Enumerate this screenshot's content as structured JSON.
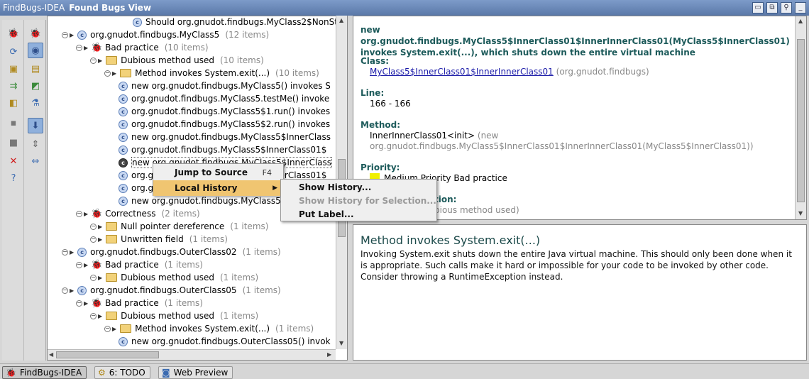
{
  "titlebar": {
    "app_name": "FindBugs-IDEA",
    "view_name": "Found Bugs View",
    "buttons": [
      "restore-icon",
      "float-icon",
      "pin-icon",
      "minimize-icon"
    ]
  },
  "toolbar1": {
    "tools": [
      {
        "name": "analyze-bug-icon",
        "glyph": "🐞"
      },
      {
        "name": "analyze-module-icon",
        "glyph": "⟳"
      },
      {
        "name": "analyze-project-icon",
        "glyph": "▣"
      },
      {
        "name": "analyze-changelist-icon",
        "glyph": "⇉"
      },
      {
        "name": "analyze-scope-icon",
        "glyph": "◧"
      },
      {
        "name": "stop-icon",
        "glyph": "■"
      },
      {
        "name": "close-icon",
        "glyph": "✕"
      },
      {
        "name": "help-icon",
        "glyph": "?"
      }
    ]
  },
  "toolbar2": {
    "tools": [
      {
        "name": "group-by-bug-icon",
        "glyph": "🐞"
      },
      {
        "name": "group-by-class-icon",
        "glyph": "◉"
      },
      {
        "name": "group-by-package-icon",
        "glyph": "▤"
      },
      {
        "name": "group-by-category-icon",
        "glyph": "◩"
      },
      {
        "name": "filter-icon",
        "glyph": "⚗"
      },
      {
        "name": "autoscroll-icon",
        "glyph": "⬇"
      },
      {
        "name": "expand-all-icon",
        "glyph": "⇕"
      },
      {
        "name": "collapse-all-icon",
        "glyph": "⇔"
      }
    ]
  },
  "tree": {
    "rows": [
      {
        "type": "cls",
        "label": "Should org.gnudot.findbugs.MyClass2$NonStat",
        "count": ""
      },
      {
        "type": "cls",
        "label": "org.gnudot.findbugs.MyClass5",
        "count": "(12 items)"
      },
      {
        "type": "bug",
        "label": "Bad practice",
        "count": "(10 items)"
      },
      {
        "type": "folder",
        "label": "Dubious method used",
        "count": "(10 items)"
      },
      {
        "type": "folder",
        "label": "Method invokes System.exit(...)",
        "count": "(10 items)"
      },
      {
        "type": "cls",
        "label": "new org.gnudot.findbugs.MyClass5() invokes S",
        "count": ""
      },
      {
        "type": "cls",
        "label": "org.gnudot.findbugs.MyClass5.testMe() invoke",
        "count": ""
      },
      {
        "type": "cls",
        "label": "org.gnudot.findbugs.MyClass5$1.run() invokes",
        "count": ""
      },
      {
        "type": "cls",
        "label": "org.gnudot.findbugs.MyClass5$2.run() invokes",
        "count": ""
      },
      {
        "type": "cls",
        "label": "new org.gnudot.findbugs.MyClass5$InnerClass",
        "count": ""
      },
      {
        "type": "cls",
        "label": "org.gnudot.findbugs.MyClass5$InnerClass01$",
        "count": ""
      },
      {
        "type": "cls",
        "label": "new org.gnudot.findbugs.MyClass5$InnerClass",
        "count": ""
      },
      {
        "type": "cls",
        "label": "org.gnudot.findbugs.MyClass5$InnerClass01$",
        "count": ""
      },
      {
        "type": "cls",
        "label": "org.gnudot.findbugs.MyClass5$InnerClass01$",
        "count": ""
      },
      {
        "type": "cls",
        "label": "new org.gnudot.findbugs.MyClass5$InnerClass",
        "count": ""
      },
      {
        "type": "bug",
        "label": "Correctness",
        "count": "(2 items)"
      },
      {
        "type": "folder",
        "label": "Null pointer dereference",
        "count": "(1 items)"
      },
      {
        "type": "folder",
        "label": "Unwritten field",
        "count": "(1 items)"
      },
      {
        "type": "cls",
        "label": "org.gnudot.findbugs.OuterClass02",
        "count": "(1 items)"
      },
      {
        "type": "bug",
        "label": "Bad practice",
        "count": "(1 items)"
      },
      {
        "type": "folder",
        "label": "Dubious method used",
        "count": "(1 items)"
      },
      {
        "type": "cls",
        "label": "org.gnudot.findbugs.OuterClass05",
        "count": "(1 items)"
      },
      {
        "type": "bug",
        "label": "Bad practice",
        "count": "(1 items)"
      },
      {
        "type": "folder",
        "label": "Dubious method used",
        "count": "(1 items)"
      },
      {
        "type": "folder",
        "label": "Method invokes System.exit(...)",
        "count": "(1 items)"
      },
      {
        "type": "cls",
        "label": "new org.gnudot.findbugs.OuterClass05() invok",
        "count": ""
      }
    ]
  },
  "context_menu": {
    "jump_to_source": "Jump to Source",
    "jump_shortcut": "F4",
    "local_history": "Local History",
    "submenu": {
      "show_history": "Show History...",
      "show_history_selection": "Show History for Selection...",
      "put_label": "Put Label..."
    }
  },
  "details": {
    "headline": "new org.gnudot.findbugs.MyClass5$InnerClass01$InnerInnerClass01(MyClass5$InnerClass01) invokes System.exit(...), which shuts down the entire virtual machine",
    "class_label": "Class:",
    "class_link": "MyClass5$InnerClass01$InnerInnerClass01",
    "class_package": "(org.gnudot.findbugs)",
    "line_label": "Line:",
    "line_value": "166 - 166",
    "method_label": "Method:",
    "method_value": "InnerInnerClass01<init>",
    "method_signature_1": "(new",
    "method_signature_2": "org.gnudot.findbugs.MyClass5$InnerClass01$InnerInnerClass01(MyClass5$InnerClass01))",
    "priority_label": "Priority:",
    "priority_value": "Medium Priority Bad practice",
    "priority_color": "#f0f000",
    "explanation_label_tail": "tion:",
    "explanation_fragment": "bious method used)"
  },
  "description": {
    "title": "Method invokes System.exit(...)",
    "body": "Invoking System.exit shuts down the entire Java virtual machine. This should only been done when it is appropriate. Such calls make it hard or impossible for your code to be invoked by other code. Consider throwing a RuntimeException instead."
  },
  "statusbar": {
    "tabs": [
      {
        "icon": "bug-icon",
        "label": "FindBugs-IDEA"
      },
      {
        "icon": "todo-icon",
        "label": "6: TODO"
      },
      {
        "icon": "web-preview-icon",
        "label": "Web Preview"
      }
    ]
  }
}
